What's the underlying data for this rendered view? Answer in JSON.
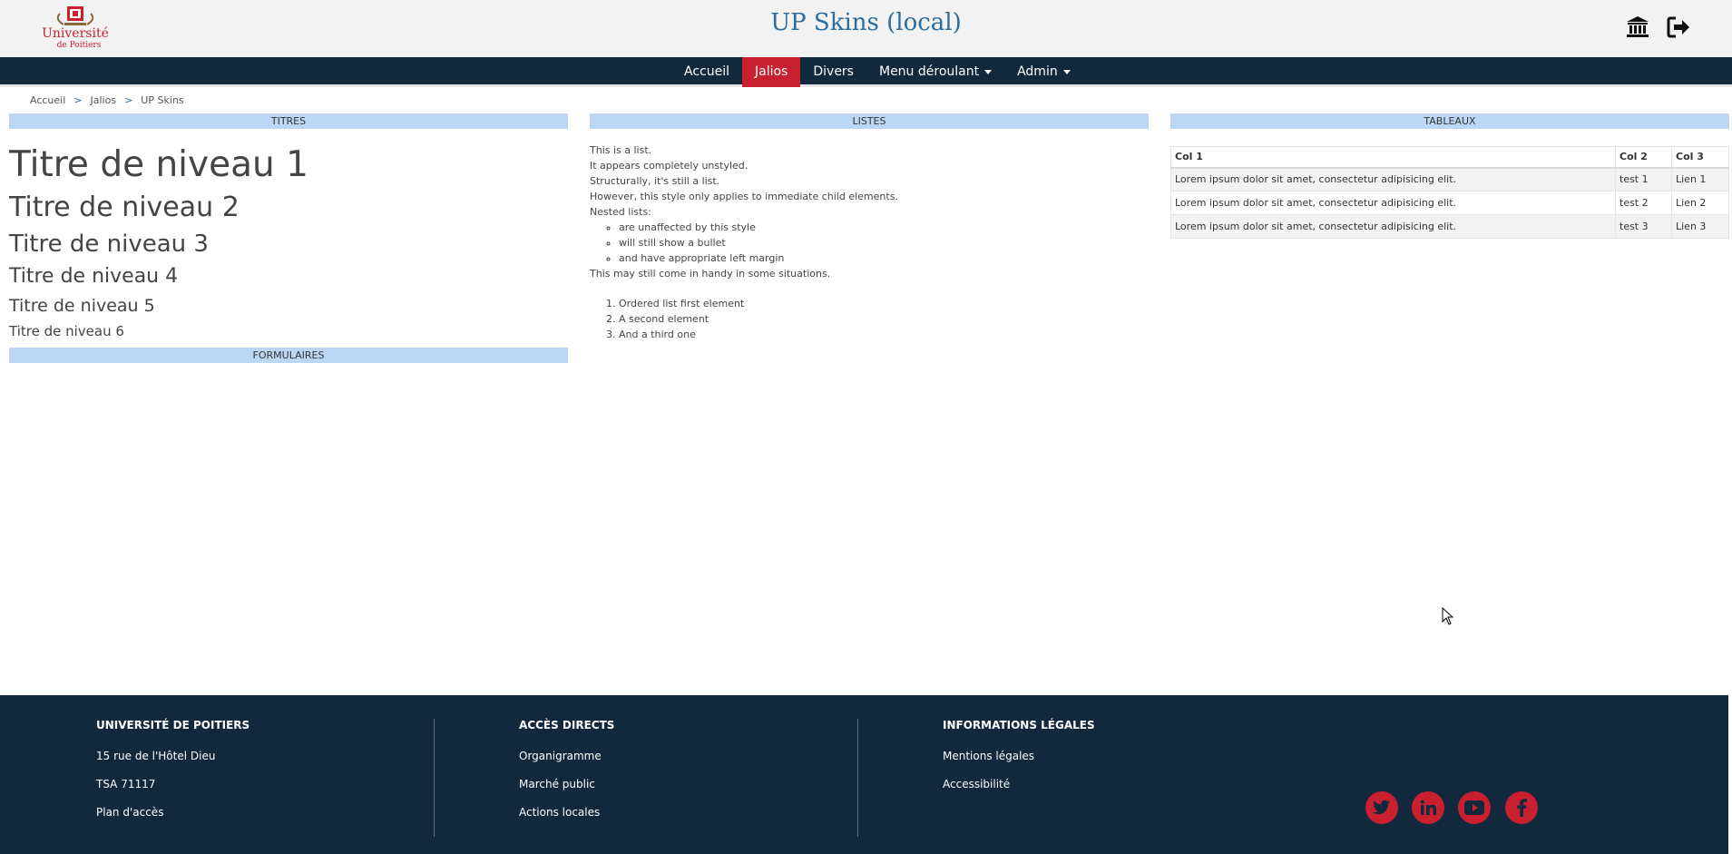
{
  "header": {
    "logo_text_1": "Université",
    "logo_text_2": "de Poitiers",
    "title": "UP Skins (local)",
    "icons": [
      "bank-icon",
      "logout-icon"
    ]
  },
  "nav": {
    "items": [
      {
        "label": "Accueil",
        "active": false
      },
      {
        "label": "Jalios",
        "active": true
      },
      {
        "label": "Divers",
        "active": false
      },
      {
        "label": "Menu déroulant",
        "active": false,
        "dropdown": true
      },
      {
        "label": "Admin",
        "active": false,
        "dropdown": true
      }
    ]
  },
  "breadcrumb": {
    "items": [
      "Accueil",
      "Jalios",
      "UP Skins"
    ],
    "separator": ">"
  },
  "titres": {
    "section_title": "TITRES",
    "h1": "Titre de niveau 1",
    "h2": "Titre de niveau 2",
    "h3": "Titre de niveau 3",
    "h4": "Titre de niveau 4",
    "h5": "Titre de niveau 5",
    "h6": "Titre de niveau 6"
  },
  "formulaires": {
    "section_title": "FORMULAIRES"
  },
  "listes": {
    "section_title": "LISTES",
    "unstyled": [
      "This is a list.",
      "It appears completely unstyled.",
      "Structurally, it's still a list.",
      "However, this style only applies to immediate child elements.",
      "Nested lists:"
    ],
    "nested": [
      "are unaffected by this style",
      "will still show a bullet",
      "and have appropriate left margin"
    ],
    "last_item": "This may still come in handy in some situations.",
    "ordered": [
      "Ordered list first element",
      "A second element",
      "And a third one"
    ]
  },
  "tableaux": {
    "section_title": "TABLEAUX",
    "columns": [
      "Col 1",
      "Col 2",
      "Col 3"
    ],
    "rows": [
      [
        "Lorem ipsum dolor sit amet, consectetur adipisicing elit.",
        "test 1",
        "Lien 1"
      ],
      [
        "Lorem ipsum dolor sit amet, consectetur adipisicing elit.",
        "test 2",
        "Lien 2"
      ],
      [
        "Lorem ipsum dolor sit amet, consectetur adipisicing elit.",
        "test 3",
        "Lien 3"
      ]
    ]
  },
  "footer": {
    "col1": {
      "title": "UNIVERSITÉ DE POITIERS",
      "items": [
        "15 rue de l'Hôtel Dieu",
        "TSA 71117",
        "Plan d'accès"
      ]
    },
    "col2": {
      "title": "ACCÈS DIRECTS",
      "items": [
        "Organigramme",
        "Marché public",
        "Actions locales"
      ]
    },
    "col3": {
      "title": "INFORMATIONS LÉGALES",
      "items": [
        "Mentions légales",
        "Accessibilité"
      ]
    },
    "social": [
      "twitter-icon",
      "linkedin-icon",
      "youtube-icon",
      "facebook-icon"
    ]
  },
  "colors": {
    "header_bg": "#f2f2f2",
    "nav_bg": "#12293d",
    "accent_red": "#c8202f",
    "title_blue": "#2a6d9e",
    "section_bg": "#bcd7f4"
  }
}
